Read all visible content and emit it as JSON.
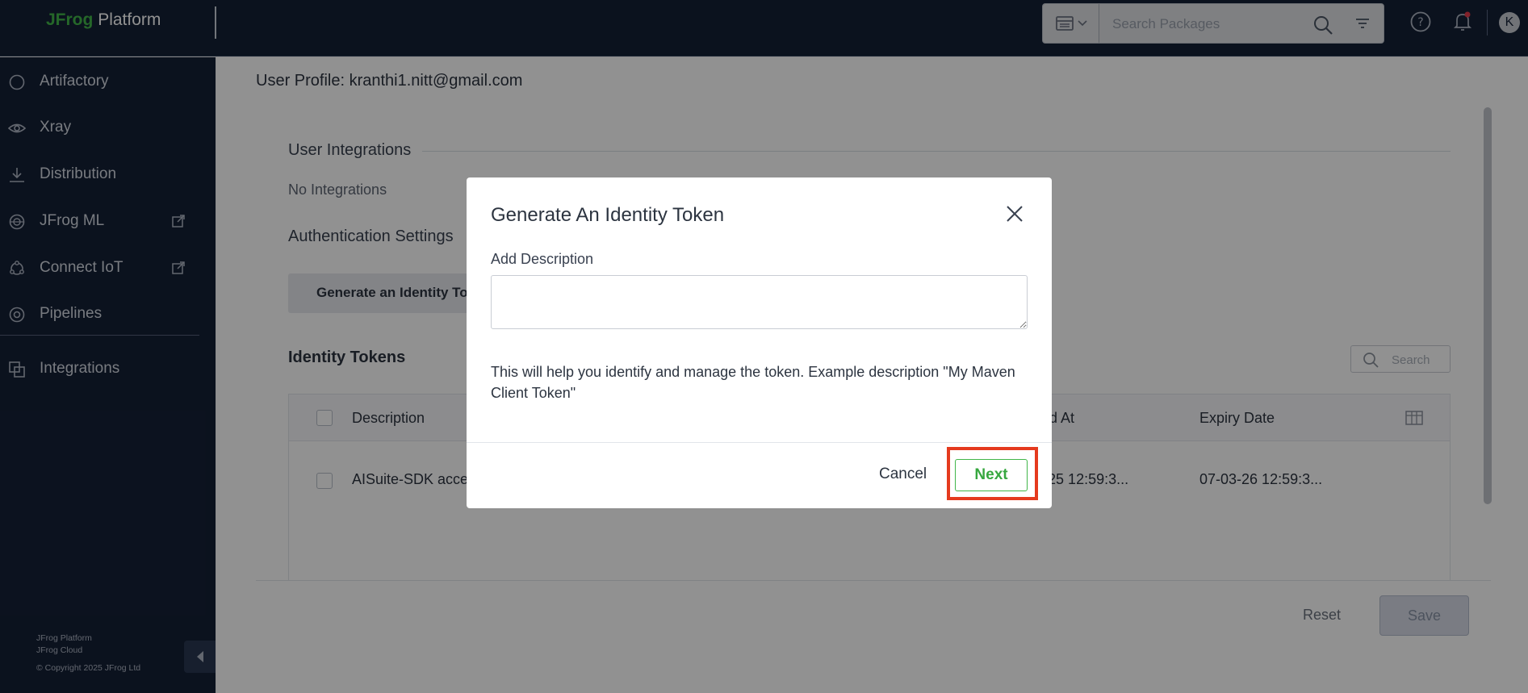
{
  "app": {
    "logo_brand": "JFrog",
    "logo_product": "Platform",
    "search_placeholder": "Search Packages",
    "avatar_initial": "K"
  },
  "sidebar": {
    "items": [
      {
        "label": "Artifactory",
        "icon": "circle-icon"
      },
      {
        "label": "Xray",
        "icon": "eye-icon"
      },
      {
        "label": "Distribution",
        "icon": "download-icon"
      },
      {
        "label": "JFrog ML",
        "icon": "ml-icon"
      },
      {
        "label": "Connect IoT",
        "icon": "iot-icon"
      },
      {
        "label": "Pipelines",
        "icon": "pipelines-icon"
      },
      {
        "label": "Integrations",
        "icon": "integrations-icon"
      }
    ],
    "footer": [
      "JFrog Platform",
      "JFrog Cloud",
      "© Copyright 2025 JFrog Ltd"
    ]
  },
  "main": {
    "profile_title": "User Profile: kranthi1.nitt@gmail.com",
    "user_integrations_title": "User Integrations",
    "no_integrations": "No Integrations",
    "auth_settings_title": "Authentication Settings",
    "generate_button": "Generate an Identity Token",
    "identity_tokens_title": "Identity Tokens",
    "token_search_placeholder": "Search",
    "table": {
      "headers": [
        "Description",
        "Created At",
        "Expiry Date"
      ],
      "rows": [
        {
          "description": "AISuite-SDK access",
          "created_at": "07-03-25 12:59:3...",
          "expiry_date": "07-03-26 12:59:3..."
        }
      ]
    },
    "reset_label": "Reset",
    "save_label": "Save"
  },
  "modal": {
    "title": "Generate An Identity Token",
    "field_label": "Add Description",
    "description_value": "",
    "help_text": "This will help you identify and manage the token. Example description \"My Maven Client Token\"",
    "cancel_label": "Cancel",
    "next_label": "Next"
  },
  "colors": {
    "topbar": "#152036",
    "brand_green": "#41b649",
    "highlight_red": "#e53a1e"
  }
}
